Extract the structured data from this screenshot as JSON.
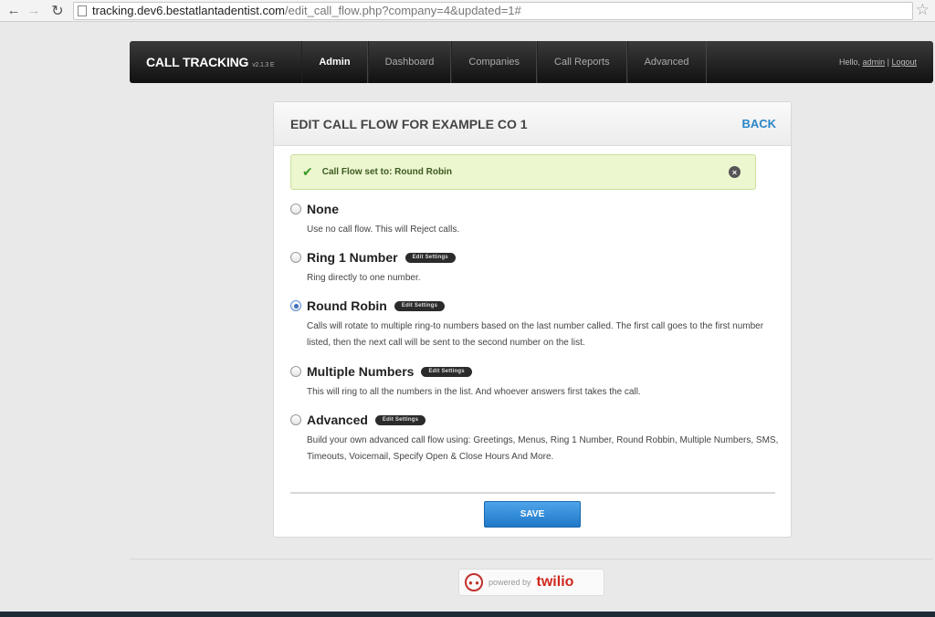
{
  "browser": {
    "url_host": "tracking.dev6.bestatlantadentist.com",
    "url_path": "/edit_call_flow.php?company=4&updated=1#"
  },
  "topbar": {
    "brand": "CALL TRACKING",
    "version": "v2.1.3 E",
    "nav": [
      "Admin",
      "Dashboard",
      "Companies",
      "Call Reports",
      "Advanced"
    ],
    "greeting": "Hello,",
    "user": "admin",
    "separator": "|",
    "logout": "Logout"
  },
  "panel": {
    "title": "EDIT CALL FLOW FOR EXAMPLE CO 1",
    "back": "BACK",
    "alert": "Call Flow set to: Round Robin",
    "edit_label": "Edit Settings",
    "options": [
      {
        "label": "None",
        "desc": "Use no call flow. This will Reject calls."
      },
      {
        "label": "Ring 1 Number",
        "desc": "Ring directly to one number."
      },
      {
        "label": "Round Robin",
        "desc": "Calls will rotate to multiple ring-to numbers based on the last number called. The first call goes to the first number listed, then the next call will be sent to the second number on the list."
      },
      {
        "label": "Multiple Numbers",
        "desc": "This will ring to all the numbers in the list. And whoever answers first takes the call."
      },
      {
        "label": "Advanced",
        "desc": "Build your own advanced call flow using: Greetings, Menus, Ring 1 Number, Round Robbin, Multiple Numbers, SMS, Timeouts, Voicemail, Specify Open & Close Hours And More."
      }
    ],
    "selected": "Round Robin",
    "save": "SAVE"
  },
  "footer": {
    "powered": "powered by",
    "brand": "twilio"
  }
}
